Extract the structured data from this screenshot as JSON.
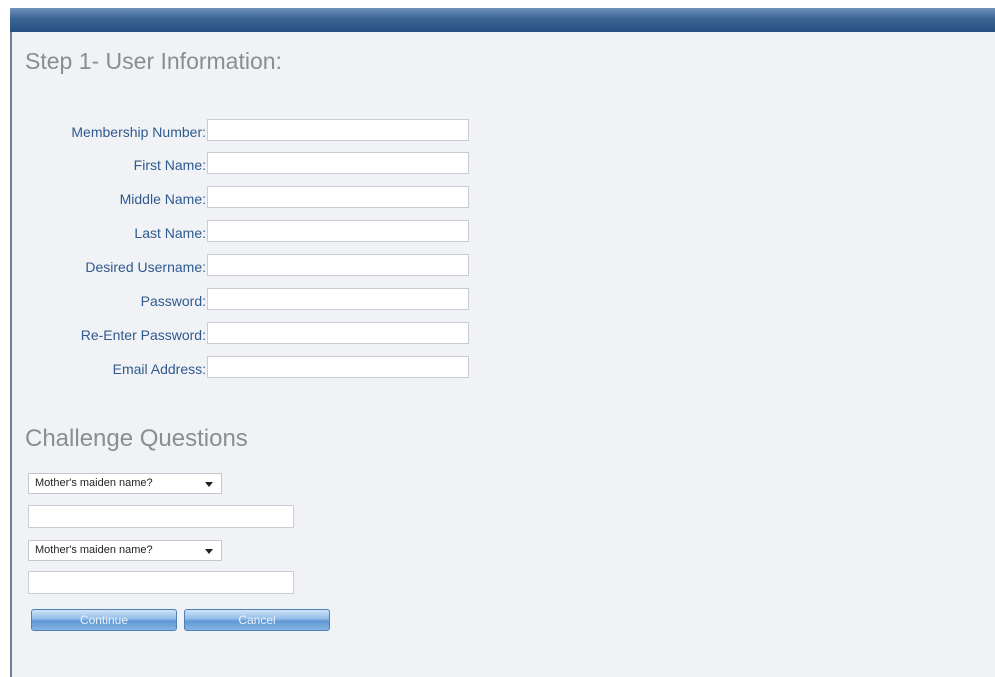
{
  "form": {
    "step_title": "Step 1- User Information:",
    "fields": [
      {
        "label": "Membership Number:",
        "value": "",
        "name": "membership-number"
      },
      {
        "label": "First Name:",
        "value": "",
        "name": "first-name"
      },
      {
        "label": "Middle Name:",
        "value": "",
        "name": "middle-name"
      },
      {
        "label": "Last Name:",
        "value": "",
        "name": "last-name"
      },
      {
        "label": "Desired Username:",
        "value": "",
        "name": "desired-username"
      },
      {
        "label": "Password:",
        "value": "",
        "name": "password"
      },
      {
        "label": "Re-Enter Password:",
        "value": "",
        "name": "re-enter-password"
      },
      {
        "label": "Email Address:",
        "value": "",
        "name": "email-address"
      }
    ]
  },
  "challenge": {
    "title": "Challenge Questions",
    "questions": [
      {
        "selected": "Mother's maiden name?",
        "answer": ""
      },
      {
        "selected": "Mother's maiden name?",
        "answer": ""
      }
    ]
  },
  "buttons": {
    "continue_label": "Continue",
    "cancel_label": "Cancel"
  },
  "colors": {
    "header_bar": "#2f5a8a",
    "label_text": "#2e5a8f",
    "title_text": "#8a8d91",
    "panel_bg": "#f0f2f5",
    "button_blue": "#5f97d4"
  }
}
